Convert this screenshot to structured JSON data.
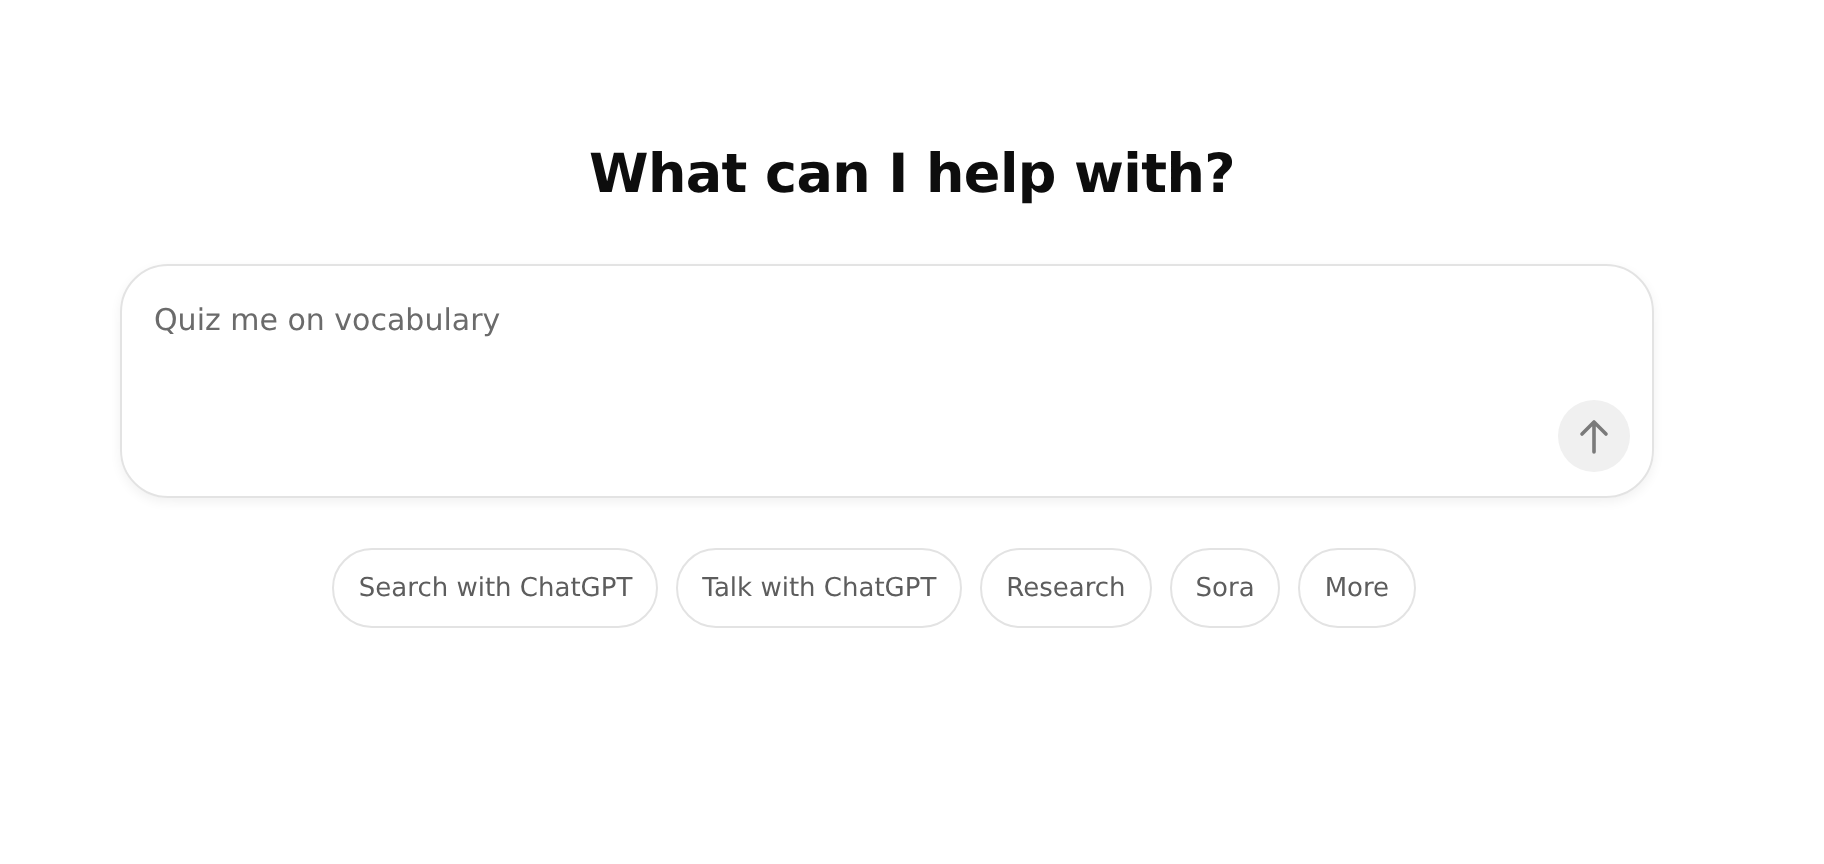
{
  "heading": "What can I help with?",
  "composer": {
    "placeholder": "Quiz me on vocabulary"
  },
  "suggestions": [
    "Search with ChatGPT",
    "Talk with ChatGPT",
    "Research",
    "Sora",
    "More"
  ]
}
